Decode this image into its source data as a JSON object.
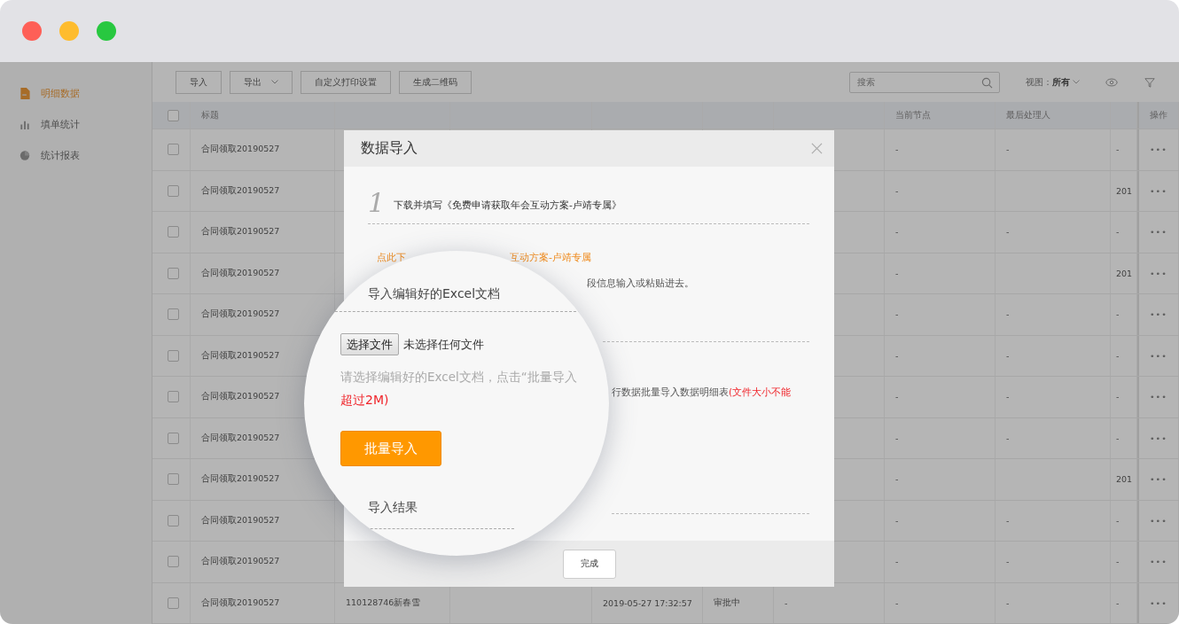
{
  "sidebar": {
    "items": [
      {
        "label": "明细数据",
        "selected": true
      },
      {
        "label": "填单统计",
        "selected": false
      },
      {
        "label": "统计报表",
        "selected": false
      }
    ]
  },
  "toolbar": {
    "buttons": [
      {
        "label": "导入",
        "dropdown": false
      },
      {
        "label": "导出",
        "dropdown": true
      },
      {
        "label": "自定义打印设置",
        "dropdown": false
      },
      {
        "label": "生成二维码",
        "dropdown": false
      }
    ],
    "search": {
      "placeholder": "搜索"
    },
    "view_label": "视图：",
    "view_value": "所有"
  },
  "table": {
    "all_checked": false,
    "headers": {
      "title": "标题",
      "node": "当前节点",
      "last": "最后处理人",
      "ops": "操作"
    },
    "rows": [
      {
        "checked": false,
        "title": "合同领取20190527",
        "node": "-",
        "last": "-",
        "last_time": "-",
        "ops": "•••"
      },
      {
        "checked": false,
        "title": "合同领取20190527",
        "node": "-",
        "last_time": "201",
        "ops": "•••"
      },
      {
        "checked": false,
        "title": "合同领取20190527",
        "node": "-",
        "last": "-",
        "last_time": "-",
        "ops": "•••"
      },
      {
        "checked": false,
        "title": "合同领取20190527",
        "node": "-",
        "last_time": "201",
        "ops": "•••"
      },
      {
        "checked": false,
        "title": "合同领取20190527",
        "node": "-",
        "last": "-",
        "last_time": "-",
        "ops": "•••"
      },
      {
        "checked": false,
        "title": "合同领取20190527",
        "node": "-",
        "last": "-",
        "last_time": "-",
        "ops": "•••"
      },
      {
        "checked": false,
        "title": "合同领取20190527",
        "node": "-",
        "last": "-",
        "last_time": "-",
        "ops": "•••"
      },
      {
        "checked": false,
        "title": "合同领取20190527",
        "node": "-",
        "last": "-",
        "last_time": "-",
        "ops": "•••"
      },
      {
        "checked": false,
        "title": "合同领取20190527",
        "node": "-",
        "last_time": "201",
        "ops": "•••"
      },
      {
        "checked": false,
        "title": "合同领取20190527",
        "node": "-",
        "last": "-",
        "last_time": "-",
        "ops": "•••"
      },
      {
        "checked": false,
        "title": "合同领取20190527",
        "node": "-",
        "last": "-",
        "last_time": "-",
        "ops": "•••"
      },
      {
        "checked": false,
        "title": "合同领取20190527",
        "code": "110128746新春雪",
        "time": "2019-05-27 17:32:57",
        "status": "审批中",
        "handler": "-",
        "node": "-",
        "last": "-",
        "last_time": "-",
        "ops": "•••"
      }
    ]
  },
  "dialog": {
    "title": "数据导入",
    "step1_number": "1",
    "step1_text": "下载并填写《免费申请获取年会互动方案-卢靖专属》",
    "link_start": "点此下",
    "link_end": "互动方案-卢靖专属",
    "fill_hint_tail": "段信息输入或粘贴进去。",
    "step2_tail": "行数据批量导入数据明细表",
    "size_note_tail": "(文件大小不能",
    "done_button": "完成"
  },
  "magnifier": {
    "step2_title": "导入编辑好的Excel文档",
    "file_button": "选择文件",
    "file_status": "未选择任何文件",
    "hint": "请选择编辑好的Excel文档，点击“批量导入",
    "size_note": "超过2M)",
    "import_button": "批量导入",
    "step3_title": "导入结果"
  }
}
